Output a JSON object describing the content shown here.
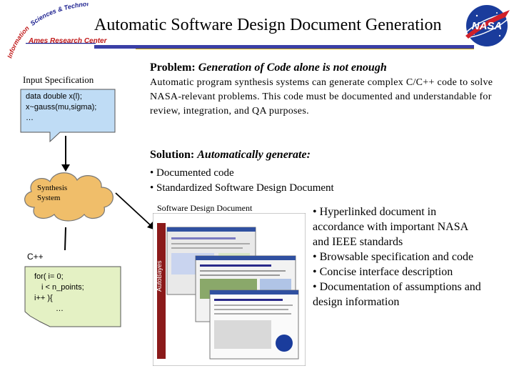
{
  "title": "Automatic Software Design Document Generation",
  "logo_left": {
    "arc_text_1": "Information",
    "arc_text_2": "Sciences & Technology",
    "center": "Ames Research Center"
  },
  "nasa_logo": {
    "text": "NASA"
  },
  "colors": {
    "title_rule": "#3a3fa6",
    "accent_rule": "#c8a400",
    "spec_box": "#bfdcf5",
    "cpp_box": "#e4f1c4",
    "cloud": "#f0be6a"
  },
  "left_panel": {
    "input_spec_label": "Input Specification",
    "spec_lines": [
      "data double x(l);",
      "x~gauss(mu,sigma);",
      "…"
    ],
    "cloud_label_line1": "Synthesis",
    "cloud_label_line2": "System",
    "cpp_label": "C++",
    "cpp_lines": [
      "for( i= 0;",
      "i < n_points;",
      "i++ ){",
      "…"
    ]
  },
  "problem": {
    "heading_prefix": "Problem: ",
    "heading_italic": "Generation of Code alone is not enough",
    "body": "Automatic program synthesis systems can generate complex C/C++ code to solve NASA-relevant problems. This code must be documented and understandable for review, integration, and QA purposes."
  },
  "solution": {
    "heading_prefix": "Solution: ",
    "heading_italic": "Automatically generate:",
    "items": [
      "• Documented code",
      "• Standardized Software Design Document"
    ]
  },
  "sdd": {
    "label": "Software Design Document",
    "screenshot_side_text": "AutoBayes"
  },
  "benefits": [
    "• Hyperlinked document in",
    "accordance with important NASA",
    "and IEEE standards",
    "• Browsable specification and code",
    "• Concise interface description",
    "• Documentation of assumptions and",
    "design information"
  ]
}
